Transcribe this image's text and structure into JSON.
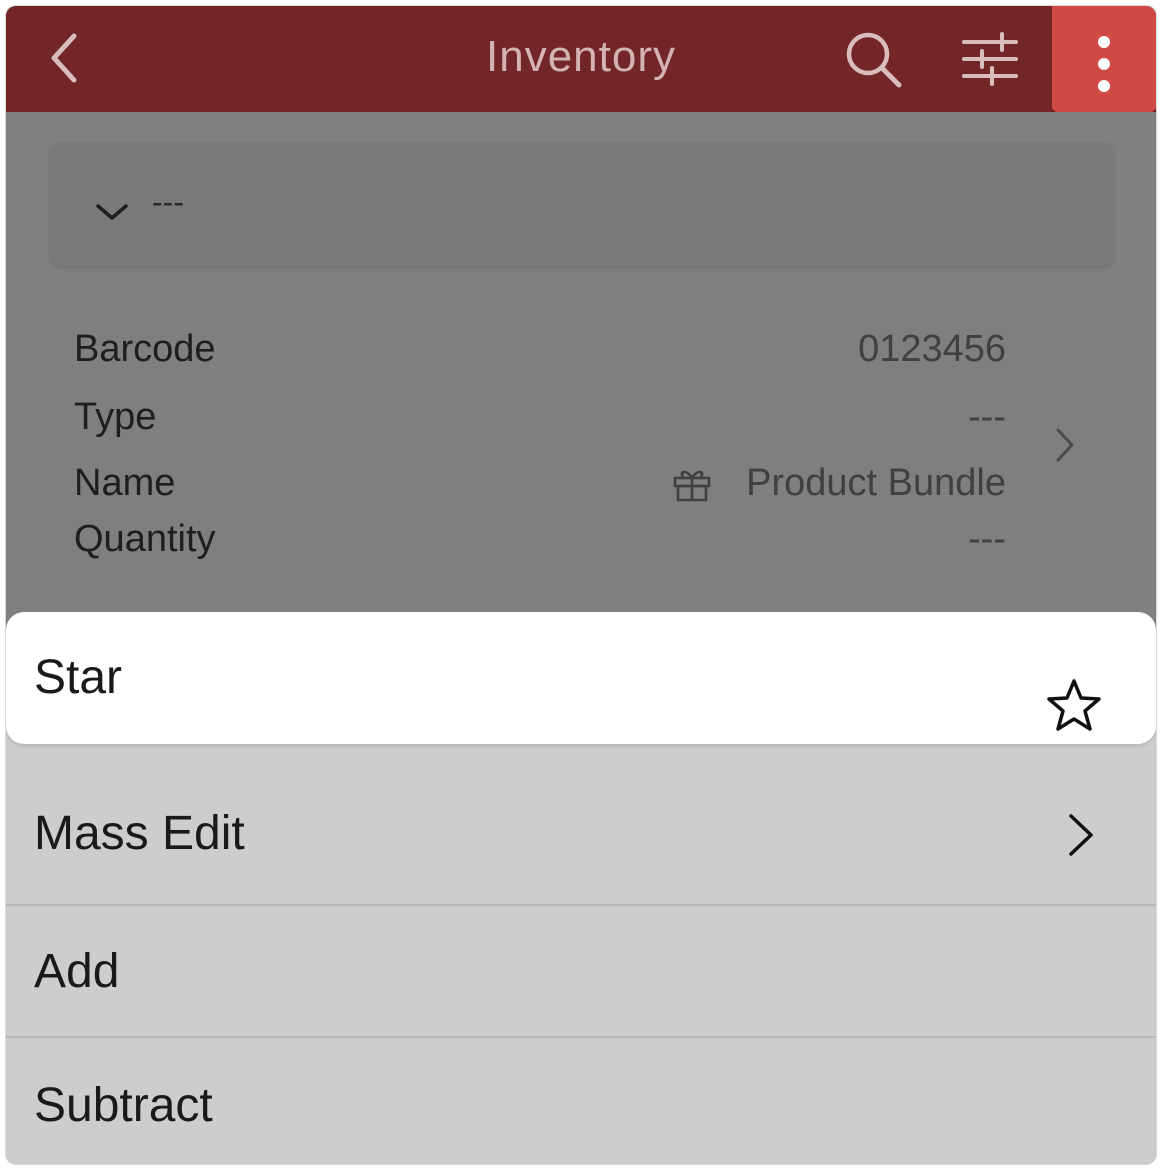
{
  "header": {
    "title": "Inventory",
    "accent_color": "#722628",
    "more_button_color": "#cf4a47",
    "icons": [
      "chevron-left-icon",
      "search-icon",
      "sliders-icon",
      "more-vertical-icon"
    ]
  },
  "dropdown": {
    "value": "---",
    "icon": "chevron-down-icon"
  },
  "record": {
    "fields": [
      {
        "label": "Barcode",
        "value": "0123456"
      },
      {
        "label": "Type",
        "value": "---"
      },
      {
        "label": "Name",
        "value": "Product Bundle",
        "icon": "gift-icon"
      },
      {
        "label": "Quantity",
        "value": "---"
      }
    ],
    "icon": "chevron-right-icon"
  },
  "action_sheet": {
    "items": [
      {
        "label": "Star",
        "icon": "star-icon"
      },
      {
        "label": "Mass Edit",
        "icon": "chevron-right-icon"
      },
      {
        "label": "Add"
      },
      {
        "label": "Subtract"
      }
    ]
  }
}
